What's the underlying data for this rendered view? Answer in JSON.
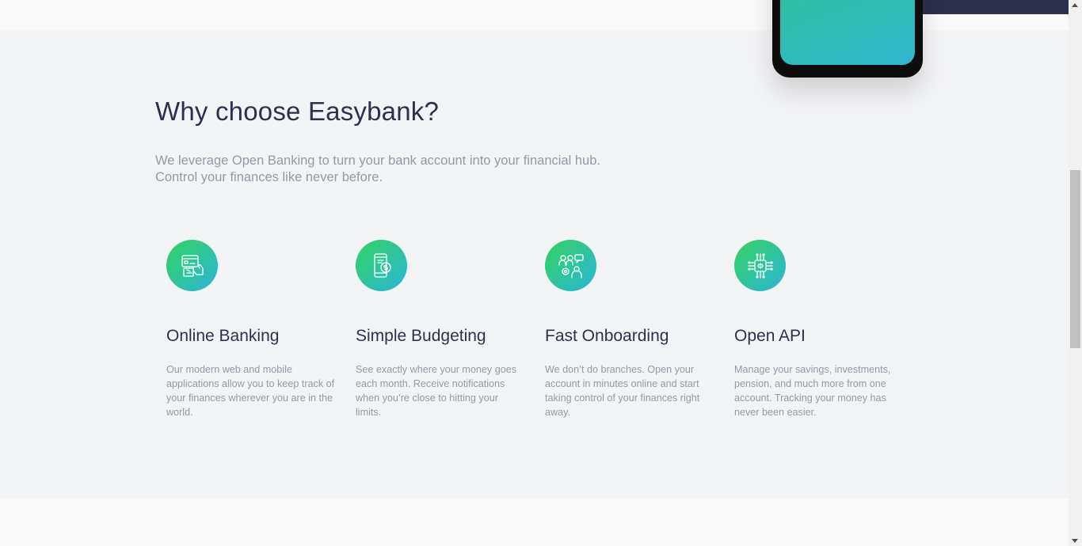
{
  "section": {
    "title": "Why choose Easybank?",
    "intro_line1": "We leverage Open Banking to turn your bank account into your financial hub.",
    "intro_line2": "Control your finances like never before."
  },
  "features": [
    {
      "icon": "online-banking-icon",
      "title": "Online Banking",
      "description": "Our modern web and mobile applications allow you to keep track of your finances wherever you are in the world."
    },
    {
      "icon": "budgeting-icon",
      "title": "Simple Budgeting",
      "description": "See exactly where your money goes each month. Receive notifications when you’re close to hitting your limits."
    },
    {
      "icon": "onboarding-icon",
      "title": "Fast Onboarding",
      "description": "We don’t do branches. Open your account in minutes online and start taking control of your finances right away."
    },
    {
      "icon": "api-icon",
      "title": "Open API",
      "description": "Manage your savings, investments, pension, and much more from one account. Tracking your money has never been easier."
    }
  ],
  "colors": {
    "dark_blue": "#2d314d",
    "grayish_blue": "#9698a6",
    "lime_green": "#33d35e",
    "bright_cyan": "#2ab6d9",
    "section_bg": "#f3f4f6"
  }
}
